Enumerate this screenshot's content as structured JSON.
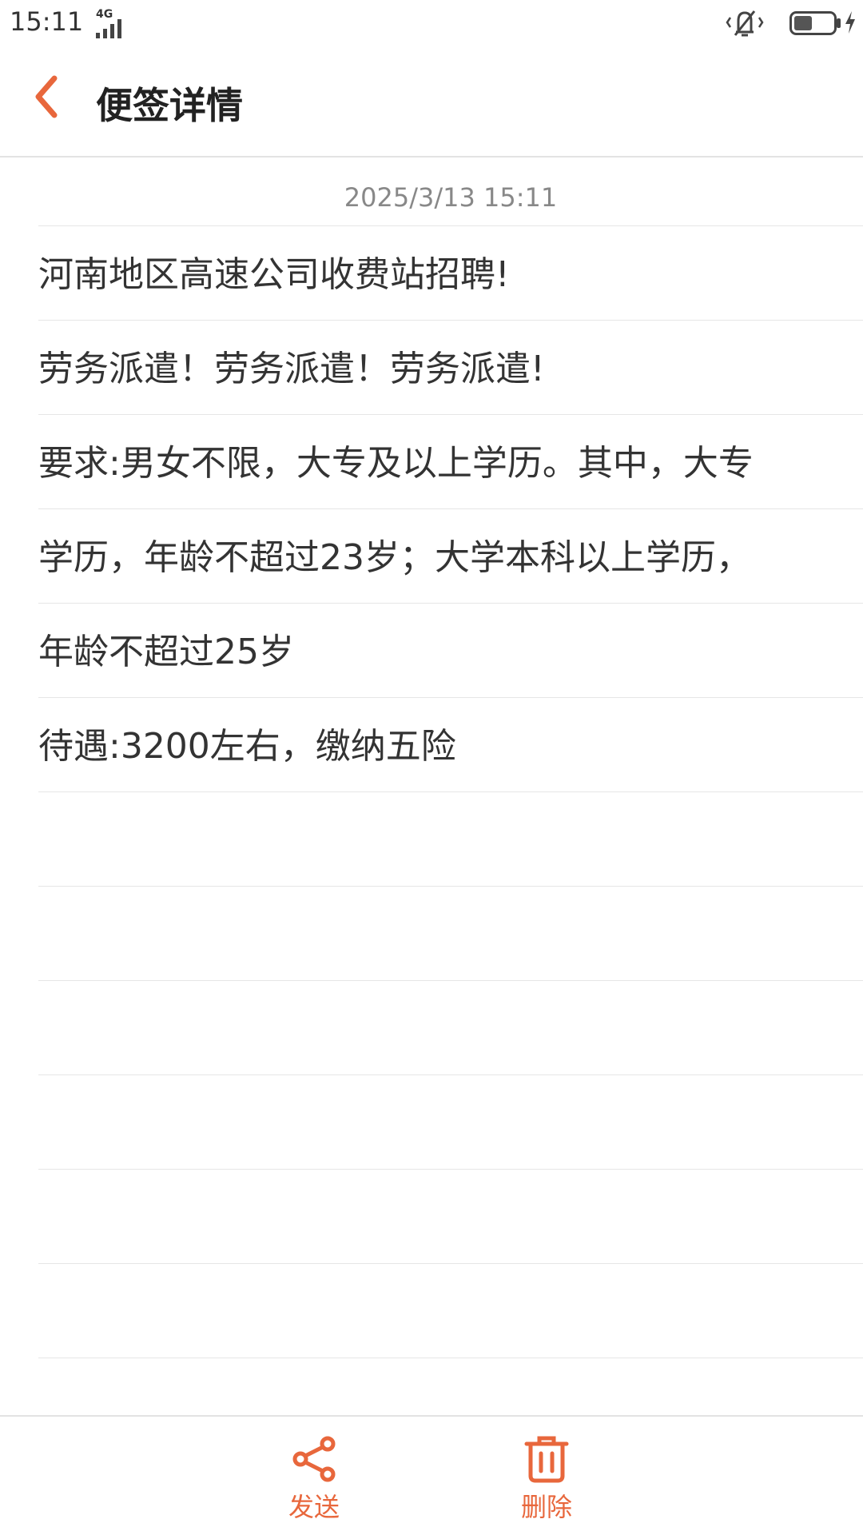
{
  "status_bar": {
    "time": "15:11",
    "network": "4G"
  },
  "header": {
    "title": "便签详情"
  },
  "note": {
    "date": "2025/3/13 15:11",
    "lines": [
      "河南地区高速公司收费站招聘!",
      "劳务派遣！劳务派遣！劳务派遣!",
      "要求:男女不限，大专及以上学历。其中，大专",
      "学历，年龄不超过23岁；大学本科以上学历，",
      "年龄不超过25岁",
      "待遇:3200左右，缴纳五险",
      "",
      "",
      "",
      "",
      "",
      "",
      ""
    ]
  },
  "actions": {
    "send_label": "发送",
    "delete_label": "删除"
  },
  "colors": {
    "accent": "#e8673c"
  }
}
